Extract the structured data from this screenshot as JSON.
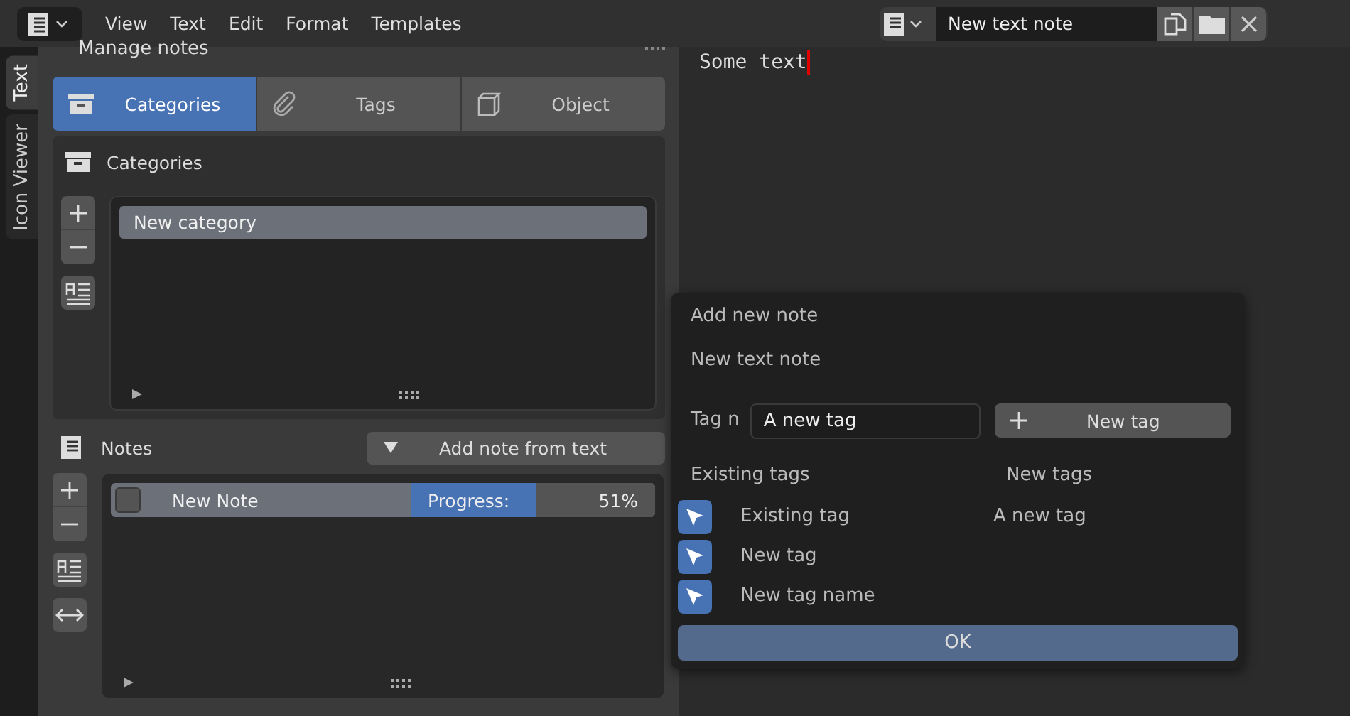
{
  "header": {
    "menu": [
      "View",
      "Text",
      "Edit",
      "Format",
      "Templates"
    ],
    "text_name": "New text note"
  },
  "side_tabs": [
    {
      "label": "Text",
      "selected": true
    },
    {
      "label": "Icon Viewer",
      "selected": false
    }
  ],
  "panel": {
    "title": "Manage notes",
    "tabs": [
      {
        "label": "Categories",
        "selected": true
      },
      {
        "label": "Tags",
        "selected": false
      },
      {
        "label": "Object",
        "selected": false
      }
    ],
    "categories": {
      "title": "Categories",
      "items": [
        {
          "label": "New category",
          "selected": true
        }
      ]
    },
    "notes": {
      "title": "Notes",
      "add_button": "Add note from text",
      "items": [
        {
          "label": "New Note",
          "checked": false,
          "progress_label": "Progress:",
          "level": 0.51,
          "reading": "51%",
          "selected": true
        }
      ]
    }
  },
  "editor": {
    "text": "Some text"
  },
  "popup": {
    "title": "Add new note",
    "name": "New text note",
    "tag_label": "Tag n",
    "tag_value": "A new tag",
    "new_tag_button": "New tag",
    "existing_heading": "Existing tags",
    "new_heading": "New tags",
    "existing": [
      "Existing tag",
      "New tag",
      "New tag name"
    ],
    "new": [
      "A new tag"
    ],
    "ok": "OK"
  }
}
